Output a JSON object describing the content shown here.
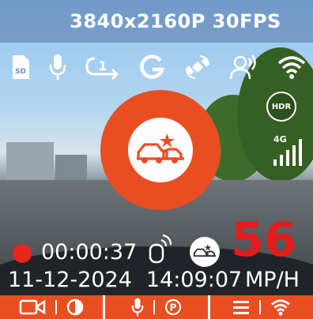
{
  "header": {
    "resolution": "3840x2160P 30FPS"
  },
  "status_icons": [
    {
      "name": "sd-card-icon",
      "text": "SD"
    },
    {
      "name": "microphone-icon"
    },
    {
      "name": "loop-recording-icon",
      "text": "1"
    },
    {
      "name": "g-sensor-icon",
      "text": "G"
    },
    {
      "name": "gps-satellite-icon"
    },
    {
      "name": "voice-control-icon"
    },
    {
      "name": "wifi-icon"
    }
  ],
  "hdr": {
    "label": "HDR"
  },
  "network": {
    "label": "4G"
  },
  "recording": {
    "elapsed": "00:00:37"
  },
  "speed": {
    "value": "56",
    "unit": "MP/H"
  },
  "datetime": {
    "date": "11-12-2024",
    "time": "14:09:07"
  },
  "colors": {
    "accent": "#e94e22",
    "rec": "#e8261b",
    "speed": "#e11d1d"
  },
  "bottom_bar": {
    "items": [
      "camera-icon",
      "brightness-icon",
      "microphone-icon",
      "parking-icon",
      "menu-icon",
      "wifi-icon"
    ]
  }
}
